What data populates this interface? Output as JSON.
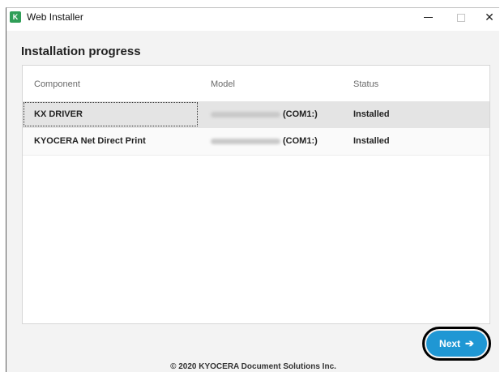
{
  "window": {
    "title": "Web Installer",
    "app_icon": "kyocera-app-icon",
    "app_icon_glyph": "⒦",
    "minimize_glyph": "",
    "maximize_glyph": "",
    "close_glyph": "✕"
  },
  "page": {
    "heading": "Installation progress"
  },
  "table": {
    "columns": [
      "Component",
      "Model",
      "Status"
    ],
    "rows": [
      {
        "component": "KX DRIVER",
        "model_port": "(COM1:)",
        "status": "Installed",
        "selected": true
      },
      {
        "component": "KYOCERA Net Direct Print",
        "model_port": "(COM1:)",
        "status": "Installed",
        "selected": false
      }
    ]
  },
  "buttons": {
    "next_label": "Next",
    "next_icon": "arrow-right-icon",
    "next_arrow_glyph": "➔"
  },
  "footer": {
    "copyright": "© 2020 KYOCERA Document Solutions Inc."
  },
  "colors": {
    "accent": "#1f97d4",
    "window_bg": "#f3f3f3",
    "selected_row": "#e4e4e4"
  }
}
